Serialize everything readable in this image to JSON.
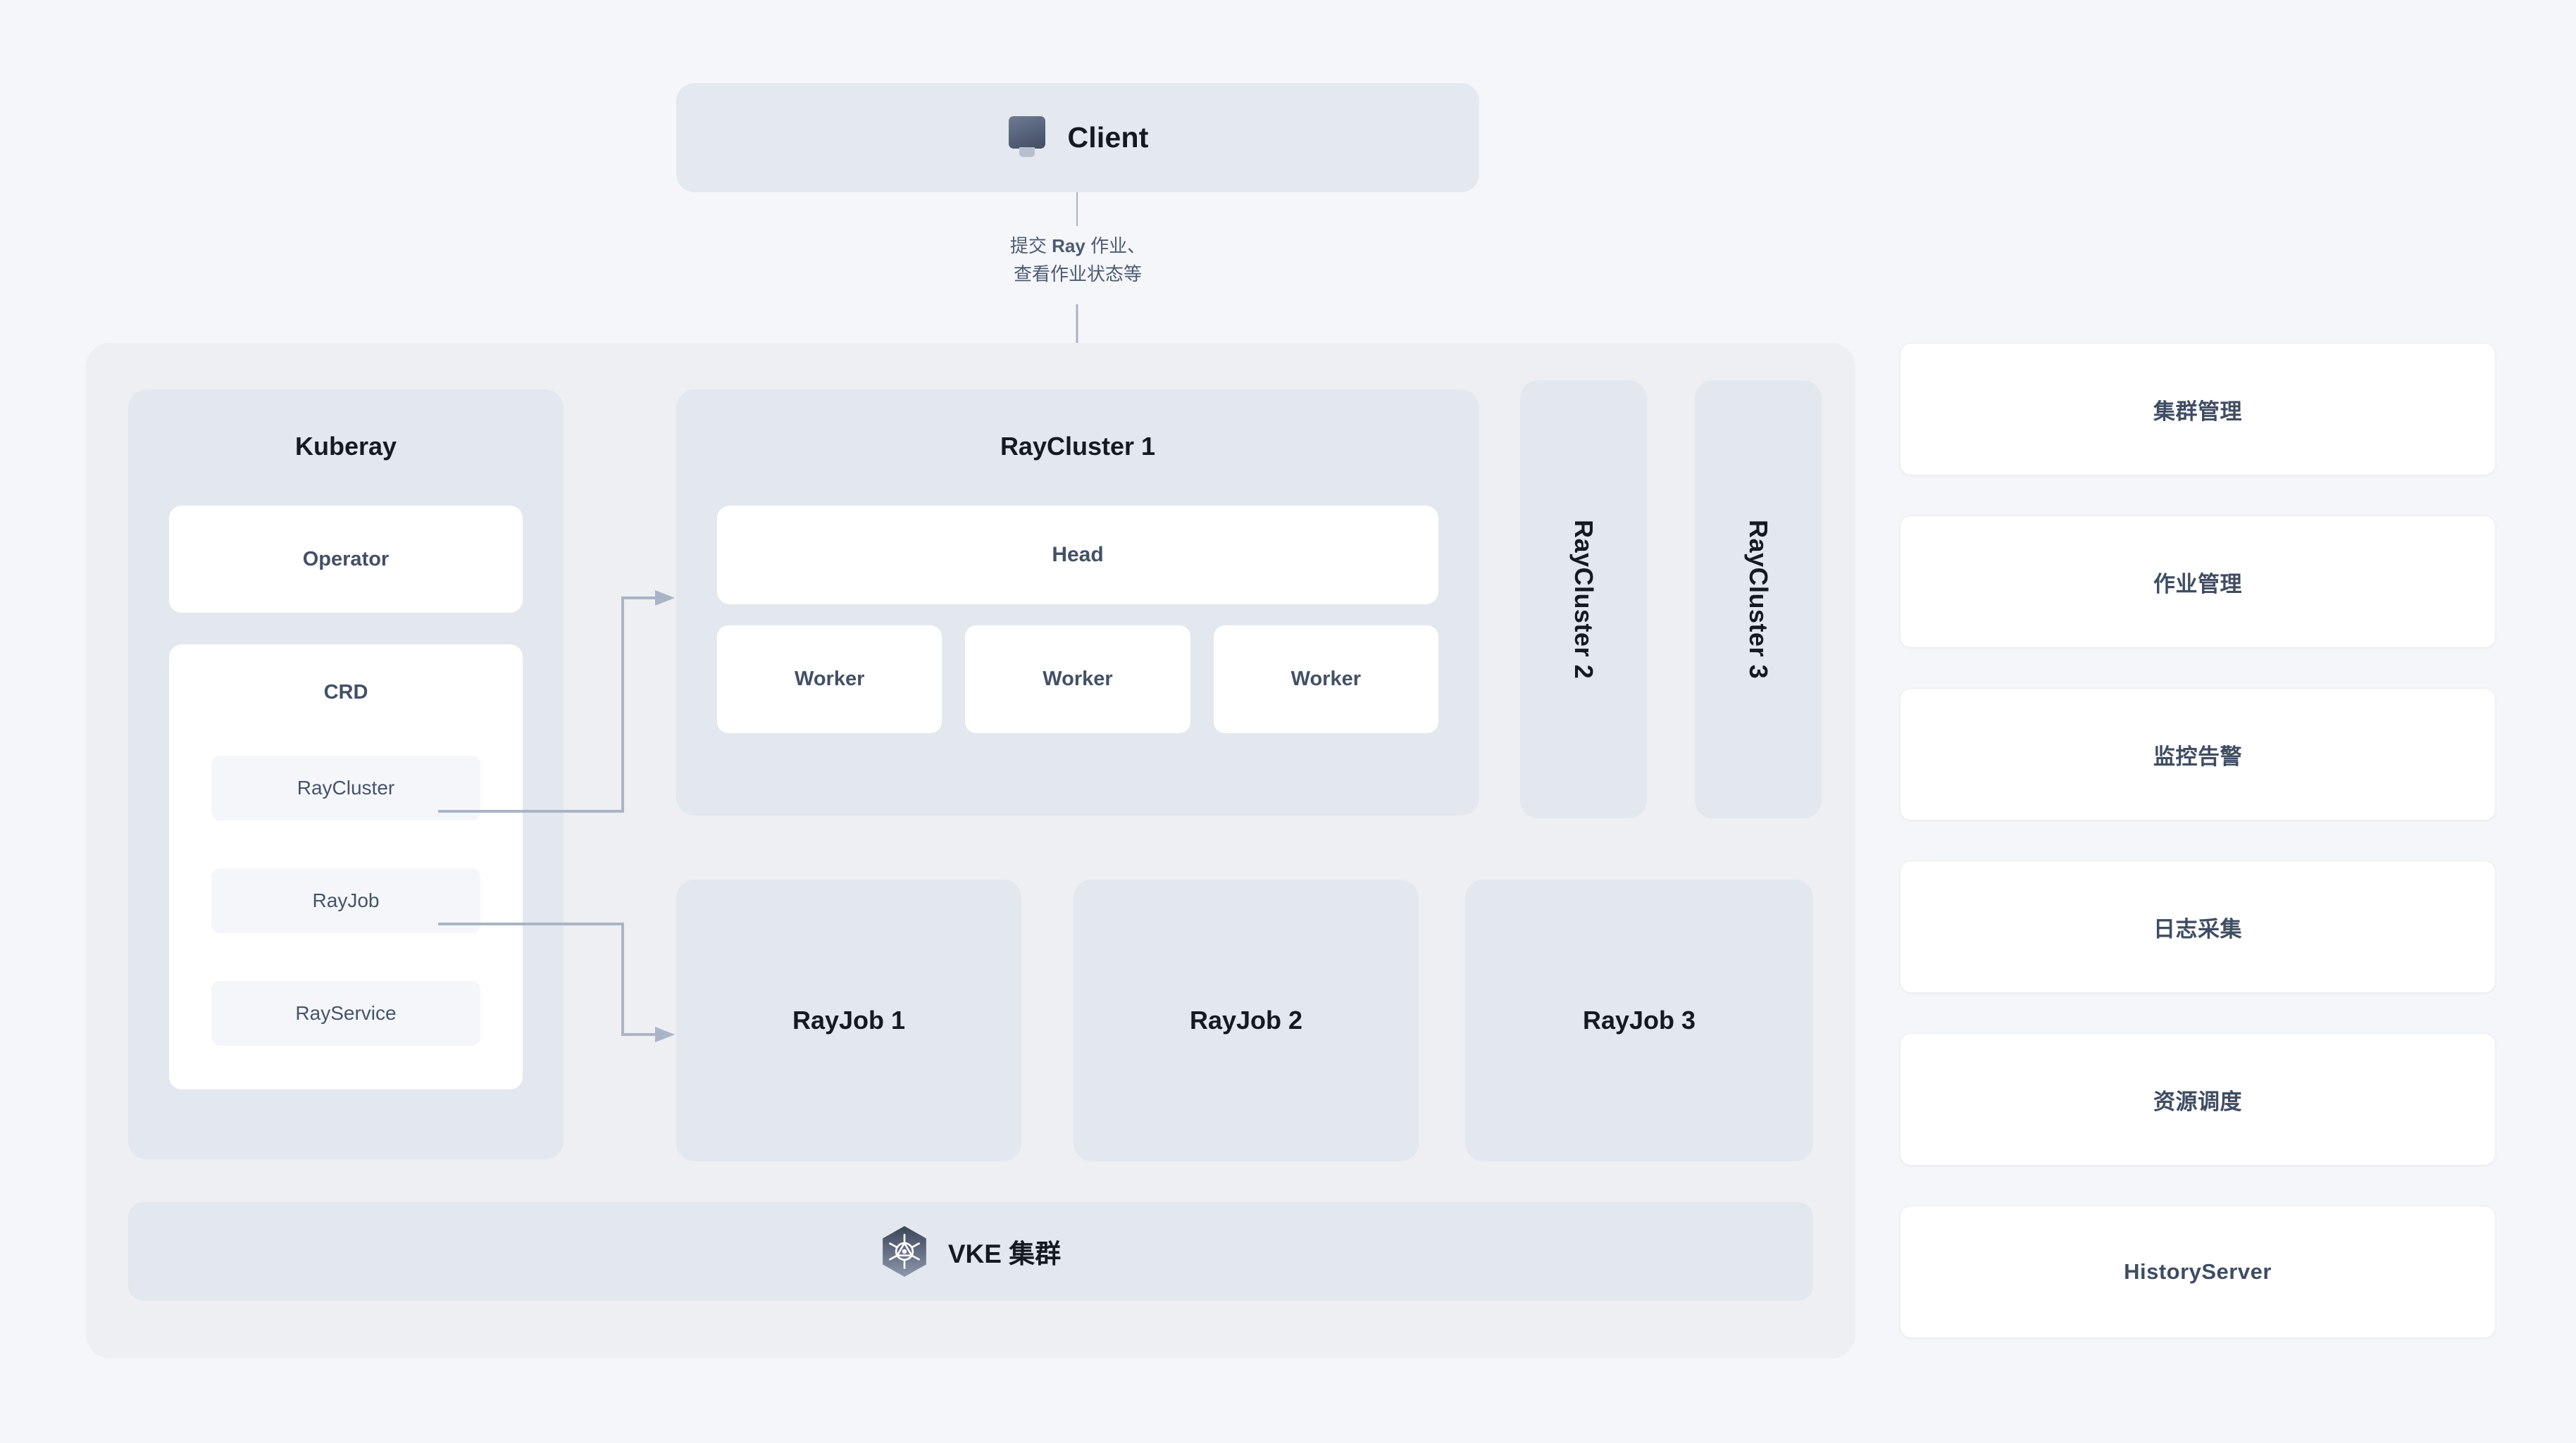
{
  "client": {
    "label": "Client",
    "icon": "monitor-icon"
  },
  "annotation": {
    "line1_prefix": "提交 ",
    "line1_bold": "Ray",
    "line1_suffix": " 作业、",
    "line2": "查看作业状态等",
    "full_text": "提交 Ray 作业、查看作业状态等"
  },
  "kuberay": {
    "title": "Kuberay",
    "operator": "Operator",
    "crd": {
      "title": "CRD",
      "chips": [
        "RayCluster",
        "RayJob",
        "RayService"
      ]
    }
  },
  "raycluster1": {
    "title": "RayCluster 1",
    "head": "Head",
    "workers": [
      "Worker",
      "Worker",
      "Worker"
    ]
  },
  "raycluster_vertical": [
    {
      "title": "RayCluster 2"
    },
    {
      "title": "RayCluster 3"
    }
  ],
  "rayjobs": [
    "RayJob 1",
    "RayJob 2",
    "RayJob 3"
  ],
  "vke": {
    "label": "VKE 集群",
    "icon": "kubernetes-icon"
  },
  "features": [
    {
      "label": "集群管理"
    },
    {
      "label": "作业管理"
    },
    {
      "label": "监控告警"
    },
    {
      "label": "日志采集"
    },
    {
      "label": "资源调度"
    },
    {
      "label": "HistoryServer"
    }
  ],
  "colors": {
    "page_background": "#f4f6f9",
    "outer_container": "#edeff3",
    "panel": "#e3e7ee",
    "card_white": "#ffffff",
    "chip": "#f4f6fa",
    "text_dark": "#141922",
    "text_slate": "#435066",
    "connector": "#a9b4c7"
  }
}
